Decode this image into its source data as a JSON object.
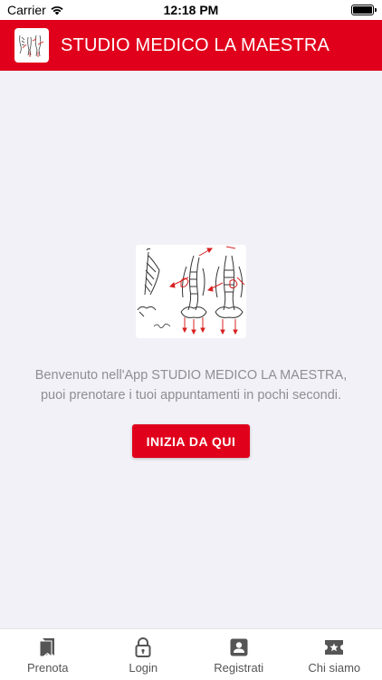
{
  "status_bar": {
    "carrier": "Carrier",
    "time": "12:18 PM"
  },
  "header": {
    "title": "STUDIO MEDICO LA MAESTRA"
  },
  "main": {
    "welcome_line1": "Benvenuto nell'App STUDIO MEDICO LA MAESTRA,",
    "welcome_line2": "puoi prenotare i tuoi appuntamenti in pochi secondi.",
    "start_button": "INIZIA DA QUI"
  },
  "tab_bar": {
    "items": [
      {
        "label": "Prenota",
        "icon": "bookmarks-icon"
      },
      {
        "label": "Login",
        "icon": "lock-icon"
      },
      {
        "label": "Registrati",
        "icon": "contact-card-icon"
      },
      {
        "label": "Chi siamo",
        "icon": "ticket-star-icon"
      }
    ]
  },
  "colors": {
    "brand": "#e0001b",
    "background": "#f2f1f7",
    "text_muted": "#8e8e93"
  }
}
